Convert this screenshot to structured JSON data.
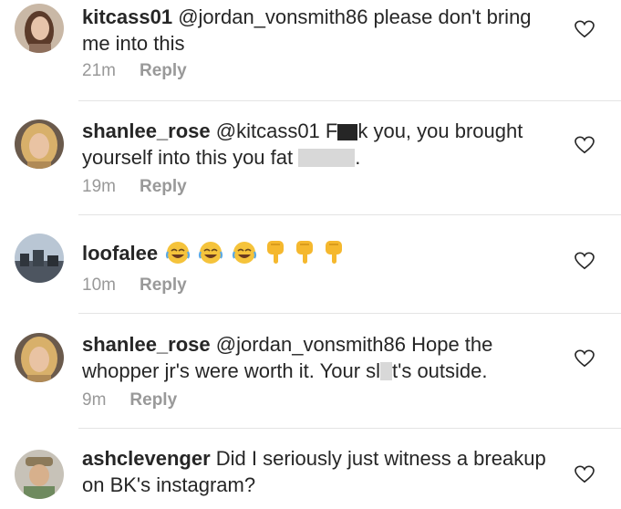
{
  "comments": [
    {
      "username": "kitcass01",
      "text": " @jordan_vonsmith86 please don't bring me into this",
      "time": "21m",
      "reply": "Reply"
    },
    {
      "username": "shanlee_rose",
      "text_before": " @kitcass01 F",
      "text_after": "k you, you brought yourself into this you fat ",
      "text_end": ".",
      "time": "19m",
      "reply": "Reply"
    },
    {
      "username": "loofalee",
      "emojis": [
        "face-with-tears-of-joy",
        "face-with-tears-of-joy",
        "face-with-tears-of-joy",
        "pointing-down-hand",
        "pointing-down-hand",
        "pointing-down-hand"
      ],
      "time": "10m",
      "reply": "Reply"
    },
    {
      "username": "shanlee_rose",
      "text_before": " @jordan_vonsmith86 Hope the whopper jr's were worth it. Your sl",
      "text_after": "t's outside.",
      "time": "9m",
      "reply": "Reply"
    },
    {
      "username": "ashclevenger",
      "text": " Did I seriously just witness a breakup on BK's instagram?"
    }
  ],
  "colors": {
    "text": "#262626",
    "meta": "#999999",
    "divider": "#e4e4e4",
    "emoji_yellow": "#f5c33b"
  },
  "icons": [
    "heart-icon",
    "avatar"
  ]
}
